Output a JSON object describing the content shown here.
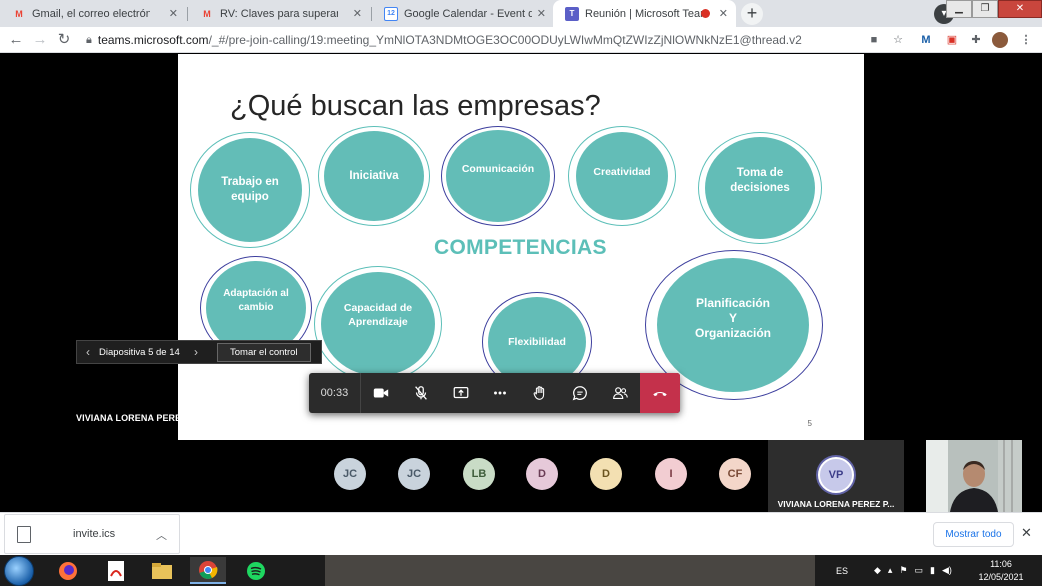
{
  "browser": {
    "tabs": [
      {
        "title": "Gmail, el correo electrónico de G",
        "icon": "gmail-icon",
        "active": false
      },
      {
        "title": "RV: Claves para superar una vide",
        "icon": "gmail-icon",
        "active": false
      },
      {
        "title": "Google Calendar - Event details",
        "icon": "calendar-icon",
        "active": false
      },
      {
        "title": "Reunión | Microsoft Teams",
        "icon": "teams-icon",
        "active": true
      }
    ],
    "new_tab_label": "+",
    "url_host": "teams.microsoft.com",
    "url_path": "/_#/pre-join-calling/19:meeting_YmNlOTA3NDMtOGE3OC00ODUyLWIwMmQtZWIzZjNlOWNkNzE1@thread.v2",
    "calendar_badge": "12"
  },
  "slide": {
    "title": "¿Qué buscan las empresas?",
    "center_label": "COMPETENCIAS",
    "number": "5",
    "bubbles": [
      {
        "label": "Trabajo en equipo"
      },
      {
        "label": "Iniciativa"
      },
      {
        "label": "Comunicación"
      },
      {
        "label": "Creatividad"
      },
      {
        "label": "Toma de decisiones"
      },
      {
        "label": "Adaptación al cambio"
      },
      {
        "label": "Capacidad de Aprendizaje"
      },
      {
        "label": "Flexibilidad"
      },
      {
        "label": "Planificación Y Organización"
      }
    ]
  },
  "slide_nav": {
    "counter": "Diapositiva 5 de 14",
    "take_control": "Tomar el control"
  },
  "presenter_name": "VIVIANA LORENA PEREZ PRINCE",
  "call": {
    "timer": "00:33"
  },
  "participants": [
    {
      "initials": "JC",
      "bg": "#c9d3dc",
      "fg": "#4a5a68"
    },
    {
      "initials": "JC",
      "bg": "#c9d3dc",
      "fg": "#4a5a68"
    },
    {
      "initials": "LB",
      "bg": "#c9dcc6",
      "fg": "#3f5d3b"
    },
    {
      "initials": "D",
      "bg": "#e6c9d9",
      "fg": "#6a3c55"
    },
    {
      "initials": "D",
      "bg": "#f3e0b2",
      "fg": "#6b5520"
    },
    {
      "initials": "I",
      "bg": "#f2cdd2",
      "fg": "#7a3a44"
    },
    {
      "initials": "CF",
      "bg": "#f3d6c9",
      "fg": "#7a4a36"
    }
  ],
  "featured": {
    "initials": "VP",
    "name": "VIVIANA LORENA PEREZ P..."
  },
  "downloads": {
    "file_name": "invite.ics",
    "show_all": "Mostrar todo"
  },
  "taskbar": {
    "lang": "ES",
    "time": "11:06",
    "date": "12/05/2021"
  }
}
